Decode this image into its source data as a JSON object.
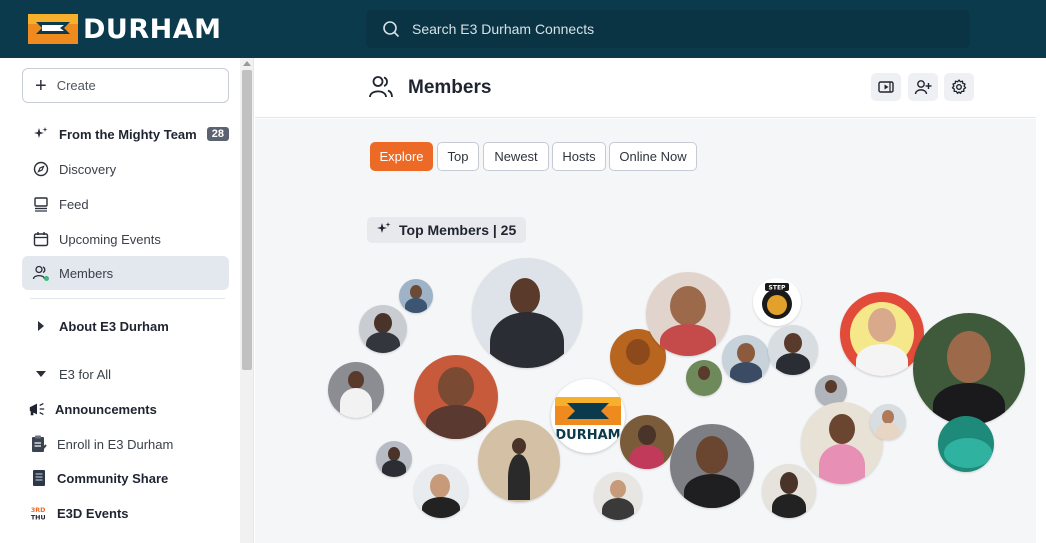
{
  "header": {
    "logo_text": "DURHAM",
    "search_placeholder": "Search E3 Durham Connects"
  },
  "sidebar": {
    "create_label": "Create",
    "items": [
      {
        "label": "From the Mighty Team",
        "badge": "28",
        "icon": "sparkle-icon"
      },
      {
        "label": "Discovery",
        "icon": "compass-icon"
      },
      {
        "label": "Feed",
        "icon": "feed-icon"
      },
      {
        "label": "Upcoming Events",
        "icon": "calendar-icon"
      },
      {
        "label": "Members",
        "icon": "members-icon"
      },
      {
        "label": "About E3 Durham",
        "icon": "caret-right-icon"
      },
      {
        "label": "E3 for All",
        "icon": "caret-down-icon"
      },
      {
        "label": "Announcements",
        "icon": "megaphone-icon"
      },
      {
        "label": "Enroll in E3 Durham",
        "icon": "clipboard-icon"
      },
      {
        "label": "Community Share",
        "icon": "book-icon"
      },
      {
        "label": "E3D Events",
        "icon": "events-logo-icon",
        "icon_text": "3RD THU"
      }
    ]
  },
  "main": {
    "title": "Members",
    "tabs": [
      {
        "label": "Explore",
        "active": true
      },
      {
        "label": "Top"
      },
      {
        "label": "Newest"
      },
      {
        "label": "Hosts"
      },
      {
        "label": "Online Now"
      }
    ],
    "top_members_label": "Top Members | 25",
    "avatar_logo_text": "DURHAM",
    "lion_badge_text": "STEP"
  },
  "colors": {
    "header_bg": "#0c3a4d",
    "accent": "#ec6a26",
    "active_nav_bg": "#e3e7ee"
  }
}
